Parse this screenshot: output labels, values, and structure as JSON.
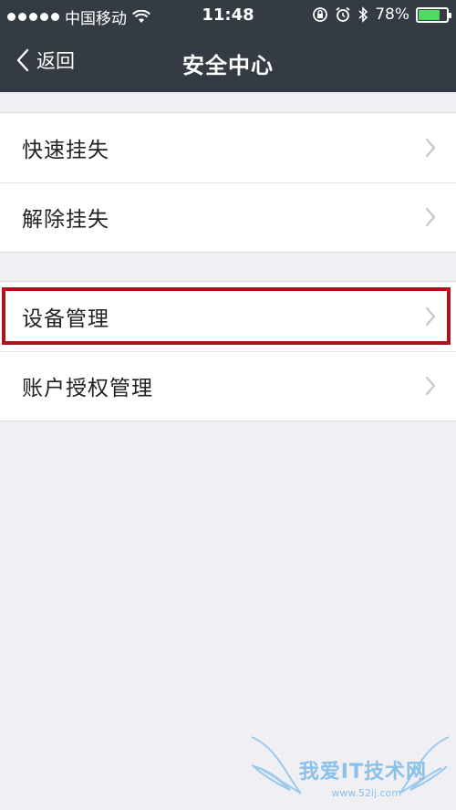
{
  "status_bar": {
    "carrier": "中国移动",
    "time": "11:48",
    "battery_percent": "78%",
    "battery_level": 0.78,
    "battery_color": "#4cd964",
    "icons": [
      "signal-dots",
      "wifi-icon",
      "rotation-lock-icon",
      "alarm-icon",
      "bluetooth-icon",
      "battery-icon"
    ]
  },
  "nav": {
    "back_label": "返回",
    "title": "安全中心",
    "background": "#353b43"
  },
  "groups": [
    {
      "items": [
        {
          "label": "快速挂失"
        },
        {
          "label": "解除挂失"
        }
      ]
    },
    {
      "items": [
        {
          "label": "设备管理",
          "highlighted": true
        },
        {
          "label": "账户授权管理"
        }
      ]
    }
  ],
  "highlight_color": "#b0121b",
  "watermark": {
    "text": "我爱IT技术网",
    "sub": "www.52ij.com"
  }
}
